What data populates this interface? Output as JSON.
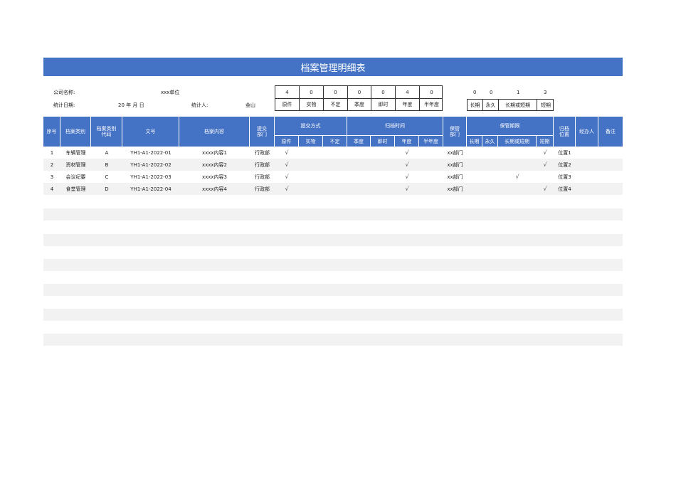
{
  "title": "档案管理明细表",
  "info": {
    "company_label": "公司名称:",
    "company_value": "xxx单位",
    "date_label": "统计日期:",
    "date_value": "20  年  月  日",
    "counter_label": "统计人:",
    "counter_value": "金山"
  },
  "summary_left": {
    "values": [
      "4",
      "0",
      "0",
      "0",
      "0",
      "4",
      "0"
    ],
    "labels": [
      "原件",
      "实物",
      "不定",
      "季度",
      "即时",
      "年度",
      "半年度"
    ]
  },
  "summary_right": {
    "values": [
      "0",
      "0",
      "1",
      "3"
    ],
    "labels": [
      "长期",
      "永久",
      "长期或短期",
      "短期"
    ]
  },
  "headers": {
    "seq": "序号",
    "category": "档案类别",
    "category_code": "档案类别代码",
    "doc_no": "文号",
    "content": "档案内容",
    "submit_dept": "提交部门",
    "submit_method": "提交方式",
    "submit_method_sub": [
      "原件",
      "实物",
      "不定"
    ],
    "archive_time": "归档时间",
    "archive_time_sub": [
      "季度",
      "即时",
      "年度",
      "半年度"
    ],
    "keep_dept": "保管部门",
    "keep_period": "保管期限",
    "keep_period_sub": [
      "长期",
      "永久",
      "长期或短期",
      "短期"
    ],
    "location": "归档位置",
    "handler": "经办人",
    "remark": "备注"
  },
  "rows": [
    {
      "seq": "1",
      "category": "车辆管理",
      "code": "A",
      "doc_no": "YH1-A1-2022-01",
      "content": "xxxx内容1",
      "dept": "行政部",
      "method_check": "√",
      "time_check": "√",
      "keep_dept": "xx部门",
      "period_check": "√",
      "location": "位置1"
    },
    {
      "seq": "2",
      "category": "资材管理",
      "code": "B",
      "doc_no": "YH1-A1-2022-02",
      "content": "xxxx内容2",
      "dept": "行政部",
      "method_check": "√",
      "time_check": "√",
      "keep_dept": "xx部门",
      "period_check": "√",
      "location": "位置2"
    },
    {
      "seq": "3",
      "category": "会议纪要",
      "code": "C",
      "doc_no": "YH1-A1-2022-03",
      "content": "xxxx内容3",
      "dept": "行政部",
      "method_check": "√",
      "time_check": "√",
      "keep_dept": "xx部门",
      "period_check": "√",
      "location": "位置3"
    },
    {
      "seq": "4",
      "category": "食堂管理",
      "code": "D",
      "doc_no": "YH1-A1-2022-04",
      "content": "xxxx内容4",
      "dept": "行政部",
      "method_check": "√",
      "time_check": "√",
      "keep_dept": "xx部门",
      "period_check": "√",
      "location": "位置4"
    }
  ]
}
